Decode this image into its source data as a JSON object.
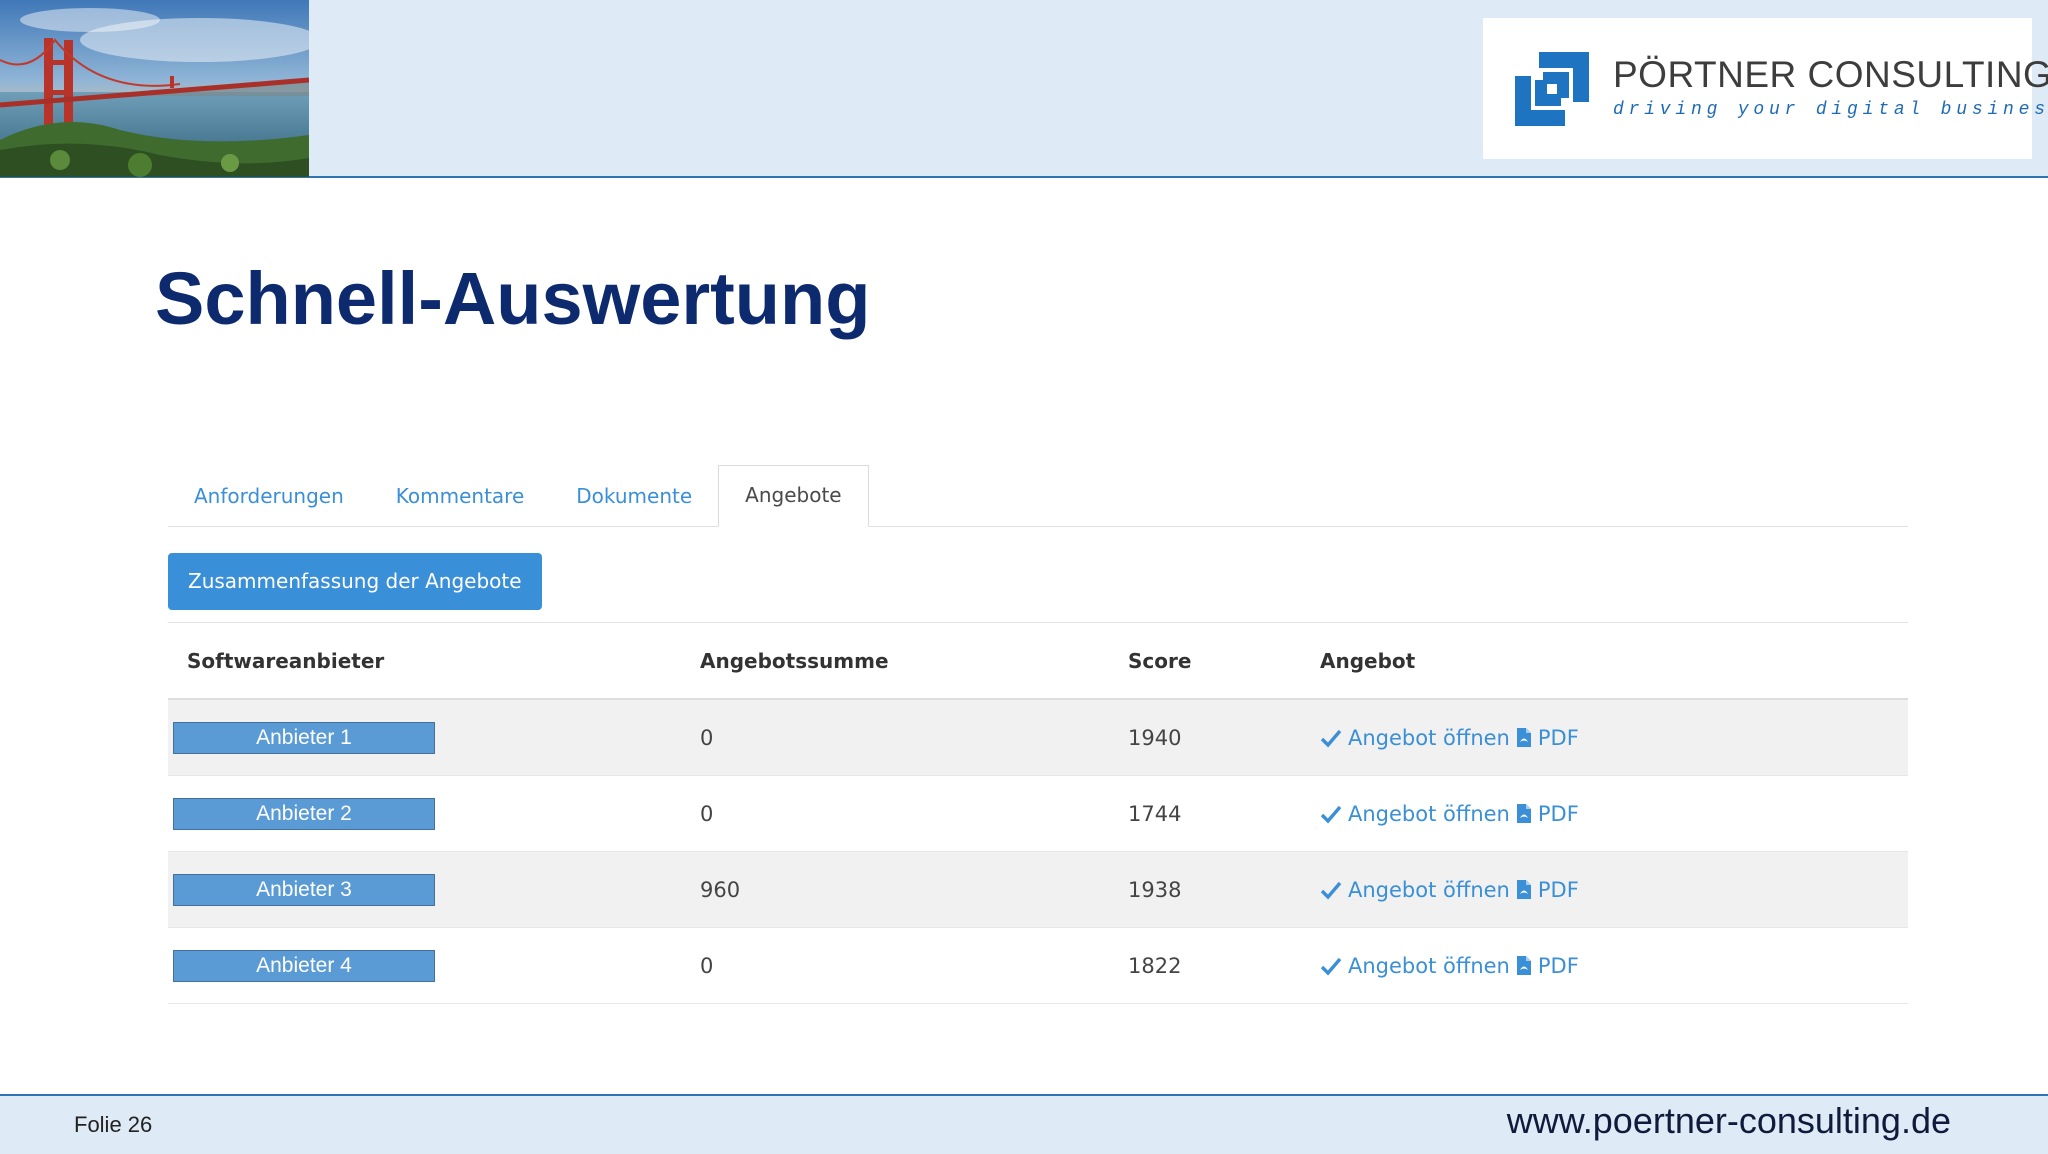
{
  "header": {
    "logo_name": "PÖRTNER CONSULTING",
    "logo_tagline": "driving your digital business"
  },
  "slide": {
    "title": "Schnell-Auswertung"
  },
  "tabs": [
    {
      "label": "Anforderungen",
      "active": false
    },
    {
      "label": "Kommentare",
      "active": false
    },
    {
      "label": "Dokumente",
      "active": false
    },
    {
      "label": "Angebote",
      "active": true
    }
  ],
  "summary_button": "Zusammenfassung der Angebote",
  "table": {
    "columns": [
      "Softwareanbieter",
      "Angebotssumme",
      "Score",
      "Angebot"
    ],
    "rows": [
      {
        "vendor": "Anbieter 1",
        "sum": "0",
        "score": "1940",
        "open_label": "Angebot öffnen",
        "pdf_label": "PDF"
      },
      {
        "vendor": "Anbieter 2",
        "sum": "0",
        "score": "1744",
        "open_label": "Angebot öffnen",
        "pdf_label": "PDF"
      },
      {
        "vendor": "Anbieter 3",
        "sum": "960",
        "score": "1938",
        "open_label": "Angebot öffnen",
        "pdf_label": "PDF"
      },
      {
        "vendor": "Anbieter 4",
        "sum": "0",
        "score": "1822",
        "open_label": "Angebot öffnen",
        "pdf_label": "PDF"
      }
    ]
  },
  "footer": {
    "slide_number": "Folie 26",
    "url": "www.poertner-consulting.de"
  },
  "colors": {
    "band": "#deebf6",
    "accent": "#2e75b6",
    "title": "#0e2a6e",
    "link": "#3a8fd6",
    "button": "#3a8fd9",
    "vendor_label": "#5b9bd5"
  }
}
